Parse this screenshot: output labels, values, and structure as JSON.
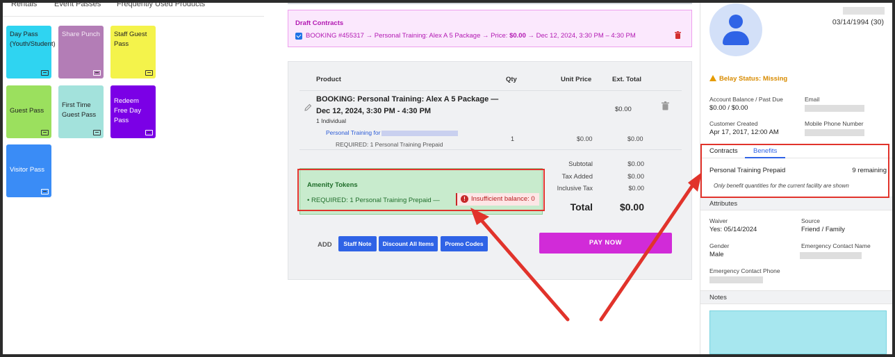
{
  "categories": [
    "Rentals",
    "Event Passes",
    "Frequently Used Products"
  ],
  "tiles": [
    {
      "label": "Day Pass (Youth/Student)",
      "color": "#2fd4f1"
    },
    {
      "label": "Share Punch",
      "color": "#b37db6"
    },
    {
      "label": "Staff Guest Pass",
      "color": "#f4f34b"
    },
    {
      "label": "Guest Pass",
      "color": "#9be05e"
    },
    {
      "label": "First Time Guest Pass",
      "color": "#a3e2dc"
    },
    {
      "label": "Redeem Free Day Pass",
      "color": "#7b00e6"
    },
    {
      "label": "Visitor Pass",
      "color": "#3a8cf6"
    }
  ],
  "draft": {
    "title": "Draft Contracts",
    "text_prefix": "BOOKING #455317 → Personal Training: Alex A 5 Package → Price: ",
    "price": "$0.00",
    "text_suffix": " → Dec 12, 2024, 3:30 PM – 4:30 PM"
  },
  "cart": {
    "headers": {
      "product": "Product",
      "qty": "Qty",
      "unit_price": "Unit Price",
      "ext_total": "Ext. Total"
    },
    "item": {
      "title": "BOOKING: Personal Training: Alex A 5 Package — Dec 12, 2024, 3:30 PM - 4:30 PM",
      "subtitle": "1 Individual",
      "ext_total": "$0.00",
      "link": "Personal Training for",
      "required": "REQUIRED: 1 Personal Training Prepaid",
      "qty": "1",
      "unit_price": "$0.00",
      "line_total": "$0.00"
    },
    "totals": {
      "subtotal_label": "Subtotal",
      "subtotal": "$0.00",
      "tax_label": "Tax Added",
      "tax": "$0.00",
      "inclusive_label": "Inclusive Tax",
      "inclusive": "$0.00",
      "total_label": "Total",
      "total": "$0.00"
    },
    "amenity": {
      "title": "Amenity Tokens",
      "required": "• REQUIRED: 1 Personal Training Prepaid —",
      "error": "Insufficient balance: 0"
    },
    "add_label": "ADD",
    "buttons": {
      "staff_note": "Staff Note",
      "discount": "Discount All Items",
      "promo": "Promo Codes"
    },
    "pay_now": "PAY NOW"
  },
  "customer": {
    "dob": "03/14/1994 (30)",
    "belay": "Belay Status: Missing",
    "balance_label": "Account Balance / Past Due",
    "balance": "$0.00 / $0.00",
    "email_label": "Email",
    "created_label": "Customer Created",
    "created": "Apr 17, 2017, 12:00 AM",
    "phone_label": "Mobile Phone Number",
    "tabs": {
      "contracts": "Contracts",
      "benefits": "Benefits"
    },
    "benefit_name": "Personal Training Prepaid",
    "benefit_remaining": "9 remaining",
    "benefit_note": "Only benefit quantities for the current facility are shown",
    "attributes_header": "Attributes",
    "waiver_label": "Waiver",
    "waiver": "Yes: 05/14/2024",
    "source_label": "Source",
    "source": "Friend / Family",
    "gender_label": "Gender",
    "gender": "Male",
    "emergency_name_label": "Emergency Contact Name",
    "emergency_phone_label": "Emergency Contact Phone",
    "notes_header": "Notes"
  }
}
